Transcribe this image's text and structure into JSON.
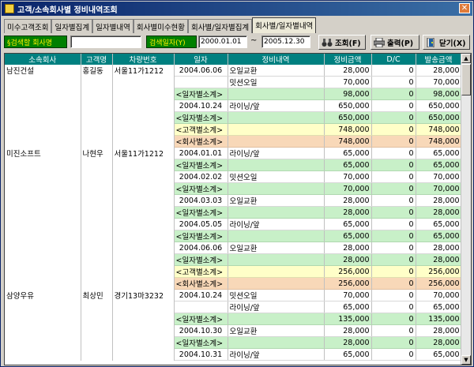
{
  "window": {
    "title": "고객/소속회사별 정비내역조회"
  },
  "tabs": [
    "미수고객조회",
    "일자별집계",
    "일자별내역",
    "회사별미수현황",
    "회사별/일자별집계",
    "회사별/일자별내역"
  ],
  "toolbar": {
    "company_search_label": "§검색할 회사명",
    "company_value": "",
    "date_label": "검색일자(Y)",
    "date_from": "2000.01.01",
    "tilde": "~",
    "date_to": "2005.12.30",
    "query_label": "조회(F)",
    "print_label": "출력(P)",
    "close_label": "닫기(X)"
  },
  "grid": {
    "headers": [
      "소속회사",
      "고객명",
      "차량번호",
      "일자",
      "정비내역",
      "정비금액",
      "D/C",
      "발송금액"
    ],
    "rows": [
      {
        "type": "date",
        "company": "남진건설",
        "customer": "홍길동",
        "car": "서울11가1212",
        "date": "2004.06.06",
        "item": "오일교환",
        "amount": "28,000",
        "dc": "0",
        "total": "28,000"
      },
      {
        "type": "date",
        "company": "",
        "customer": "",
        "car": "",
        "date": "",
        "item": "밋션오일",
        "amount": "70,000",
        "dc": "0",
        "total": "70,000"
      },
      {
        "type": "dsub",
        "company": "",
        "customer": "",
        "car": "",
        "date": "<일자별소계>",
        "item": "",
        "amount": "98,000",
        "dc": "0",
        "total": "98,000"
      },
      {
        "type": "date",
        "company": "",
        "customer": "",
        "car": "",
        "date": "2004.10.24",
        "item": "라이닝/앞",
        "amount": "650,000",
        "dc": "0",
        "total": "650,000"
      },
      {
        "type": "dsub",
        "company": "",
        "customer": "",
        "car": "",
        "date": "<일자별소계>",
        "item": "",
        "amount": "650,000",
        "dc": "0",
        "total": "650,000"
      },
      {
        "type": "csub",
        "company": "",
        "customer": "",
        "car": "",
        "date": "<고객별소계>",
        "item": "",
        "amount": "748,000",
        "dc": "0",
        "total": "748,000"
      },
      {
        "type": "comp",
        "company": "",
        "customer": "",
        "car": "",
        "date": "<회사별소계>",
        "item": "",
        "amount": "748,000",
        "dc": "0",
        "total": "748,000"
      },
      {
        "type": "date",
        "company": "미진소프트",
        "customer": "나현우",
        "car": "서울11가1212",
        "date": "2004.01.01",
        "item": "라이닝/앞",
        "amount": "65,000",
        "dc": "0",
        "total": "65,000"
      },
      {
        "type": "dsub",
        "company": "",
        "customer": "",
        "car": "",
        "date": "<일자별소계>",
        "item": "",
        "amount": "65,000",
        "dc": "0",
        "total": "65,000"
      },
      {
        "type": "date",
        "company": "",
        "customer": "",
        "car": "",
        "date": "2004.02.02",
        "item": "밋션오일",
        "amount": "70,000",
        "dc": "0",
        "total": "70,000"
      },
      {
        "type": "dsub",
        "company": "",
        "customer": "",
        "car": "",
        "date": "<일자별소계>",
        "item": "",
        "amount": "70,000",
        "dc": "0",
        "total": "70,000"
      },
      {
        "type": "date",
        "company": "",
        "customer": "",
        "car": "",
        "date": "2004.03.03",
        "item": "오일교환",
        "amount": "28,000",
        "dc": "0",
        "total": "28,000"
      },
      {
        "type": "dsub",
        "company": "",
        "customer": "",
        "car": "",
        "date": "<일자별소계>",
        "item": "",
        "amount": "28,000",
        "dc": "0",
        "total": "28,000"
      },
      {
        "type": "date",
        "company": "",
        "customer": "",
        "car": "",
        "date": "2004.05.05",
        "item": "라이닝/앞",
        "amount": "65,000",
        "dc": "0",
        "total": "65,000"
      },
      {
        "type": "dsub",
        "company": "",
        "customer": "",
        "car": "",
        "date": "<일자별소계>",
        "item": "",
        "amount": "65,000",
        "dc": "0",
        "total": "65,000"
      },
      {
        "type": "date",
        "company": "",
        "customer": "",
        "car": "",
        "date": "2004.06.06",
        "item": "오일교환",
        "amount": "28,000",
        "dc": "0",
        "total": "28,000"
      },
      {
        "type": "dsub",
        "company": "",
        "customer": "",
        "car": "",
        "date": "<일자별소계>",
        "item": "",
        "amount": "28,000",
        "dc": "0",
        "total": "28,000"
      },
      {
        "type": "csub",
        "company": "",
        "customer": "",
        "car": "",
        "date": "<고객별소계>",
        "item": "",
        "amount": "256,000",
        "dc": "0",
        "total": "256,000"
      },
      {
        "type": "comp",
        "company": "",
        "customer": "",
        "car": "",
        "date": "<회사별소계>",
        "item": "",
        "amount": "256,000",
        "dc": "0",
        "total": "256,000"
      },
      {
        "type": "date",
        "company": "삼양우유",
        "customer": "최상민",
        "car": "경기13마3232",
        "date": "2004.10.24",
        "item": "밋션오일",
        "amount": "70,000",
        "dc": "0",
        "total": "70,000"
      },
      {
        "type": "date",
        "company": "",
        "customer": "",
        "car": "",
        "date": "",
        "item": "라이닝/앞",
        "amount": "65,000",
        "dc": "0",
        "total": "65,000"
      },
      {
        "type": "dsub",
        "company": "",
        "customer": "",
        "car": "",
        "date": "<일자별소계>",
        "item": "",
        "amount": "135,000",
        "dc": "0",
        "total": "135,000"
      },
      {
        "type": "date",
        "company": "",
        "customer": "",
        "car": "",
        "date": "2004.10.30",
        "item": "오일교환",
        "amount": "28,000",
        "dc": "0",
        "total": "28,000"
      },
      {
        "type": "dsub",
        "company": "",
        "customer": "",
        "car": "",
        "date": "<일자별소계>",
        "item": "",
        "amount": "28,000",
        "dc": "0",
        "total": "28,000"
      },
      {
        "type": "date",
        "company": "",
        "customer": "",
        "car": "",
        "date": "2004.10.31",
        "item": "라이닝/앞",
        "amount": "65,000",
        "dc": "0",
        "total": "65,000"
      }
    ]
  }
}
